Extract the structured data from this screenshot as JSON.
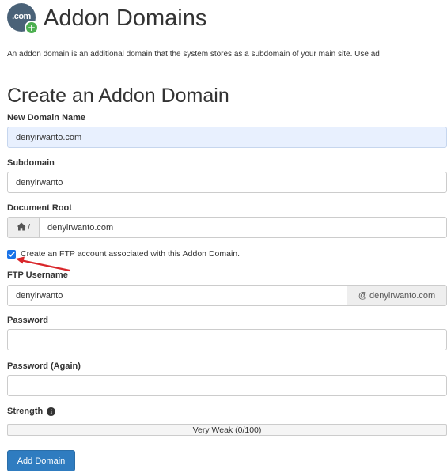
{
  "header": {
    "logo_text": ".com",
    "logo_plus": "+",
    "title": "Addon Domains"
  },
  "description": "An addon domain is an additional domain that the system stores as a subdomain of your main site. Use ad",
  "form": {
    "section_title": "Create an Addon Domain",
    "new_domain": {
      "label": "New Domain Name",
      "value": "denyirwanto.com"
    },
    "subdomain": {
      "label": "Subdomain",
      "value": "denyirwanto"
    },
    "document_root": {
      "label": "Document Root",
      "prefix": "/",
      "value": "denyirwanto.com"
    },
    "ftp_checkbox": {
      "label": "Create an FTP account associated with this Addon Domain.",
      "checked": true
    },
    "ftp_username": {
      "label": "FTP Username",
      "value": "denyirwanto",
      "suffix": "@ denyirwanto.com"
    },
    "password": {
      "label": "Password",
      "value": ""
    },
    "password_again": {
      "label": "Password (Again)",
      "value": ""
    },
    "strength": {
      "label": "Strength",
      "meter_text": "Very Weak (0/100)",
      "score": 0
    },
    "submit_label": "Add Domain"
  },
  "colors": {
    "primary_button": "#2f7cc0",
    "checkbox": "#1a73e8",
    "annotation_arrow": "#d9262a",
    "logo_bg": "#4a6278",
    "logo_plus": "#4caf50"
  },
  "icons": {
    "logo": "com-domain-logo-icon",
    "plus": "plus-badge-icon",
    "home": "home-icon",
    "info": "info-icon",
    "check": "checkmark-icon",
    "arrow": "annotation-arrow-icon"
  }
}
